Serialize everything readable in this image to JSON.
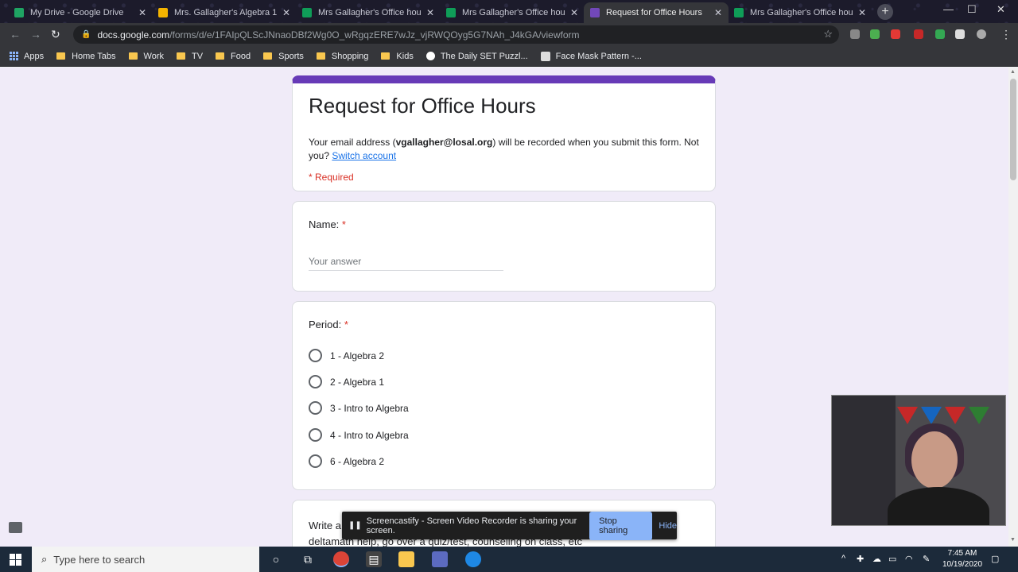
{
  "browser": {
    "tabs": [
      {
        "title": "My Drive - Google Drive",
        "favicon_color": "#1fa463",
        "active": false
      },
      {
        "title": "Mrs. Gallagher's Algebra 1 C",
        "favicon_color": "#f4b400",
        "active": false
      },
      {
        "title": "Mrs Gallagher's Office hours",
        "favicon_color": "#0f9d58",
        "active": false
      },
      {
        "title": "Mrs Gallagher's Office hours",
        "favicon_color": "#0f9d58",
        "active": false
      },
      {
        "title": "Request for Office Hours",
        "favicon_color": "#7248b9",
        "active": true
      },
      {
        "title": "Mrs Gallagher's Office hours",
        "favicon_color": "#0f9d58",
        "active": false
      }
    ],
    "new_tab_label": "+",
    "url_host": "docs.google.com",
    "url_path": "/forms/d/e/1FAIpQLScJNnaoDBf2Wg0O_wRgqzERE7wJz_vjRWQOyg5G7NAh_J4kGA/viewform",
    "bookmarks": [
      {
        "label": "Apps",
        "kind": "apps"
      },
      {
        "label": "Home Tabs",
        "kind": "folder"
      },
      {
        "label": "Work",
        "kind": "folder"
      },
      {
        "label": "TV",
        "kind": "folder"
      },
      {
        "label": "Food",
        "kind": "folder"
      },
      {
        "label": "Sports",
        "kind": "folder"
      },
      {
        "label": "Shopping",
        "kind": "folder"
      },
      {
        "label": "Kids",
        "kind": "folder"
      },
      {
        "label": "The Daily SET Puzzl...",
        "kind": "site"
      },
      {
        "label": "Face Mask Pattern -...",
        "kind": "site"
      }
    ]
  },
  "form": {
    "accent_color": "#673ab7",
    "title": "Request for Office Hours",
    "email_prefix": "Your email address (",
    "email": "vgallagher@losal.org",
    "email_suffix": ") will be recorded when you submit this form. Not you?",
    "switch_account": "Switch account",
    "required_note": "* Required",
    "questions": {
      "name": {
        "label": "Name:",
        "required_mark": "*",
        "placeholder": "Your answer"
      },
      "period": {
        "label": "Period:",
        "required_mark": "*",
        "options": [
          "1 - Algebra 2",
          "2 - Algebra 1",
          "3 - Intro to Algebra",
          "4 - Intro to Algebra",
          "6 - Algebra 2"
        ]
      },
      "write_partial_line1": "Write a",
      "write_partial_line2": "deltamath help, go over a quiz/test, counseling on class, etc"
    }
  },
  "screen_share": {
    "message": "Screencastify - Screen Video Recorder is sharing your screen.",
    "stop_label": "Stop sharing",
    "hide_label": "Hide"
  },
  "taskbar": {
    "search_placeholder": "Type here to search",
    "time": "7:45 AM",
    "date": "10/19/2020"
  }
}
